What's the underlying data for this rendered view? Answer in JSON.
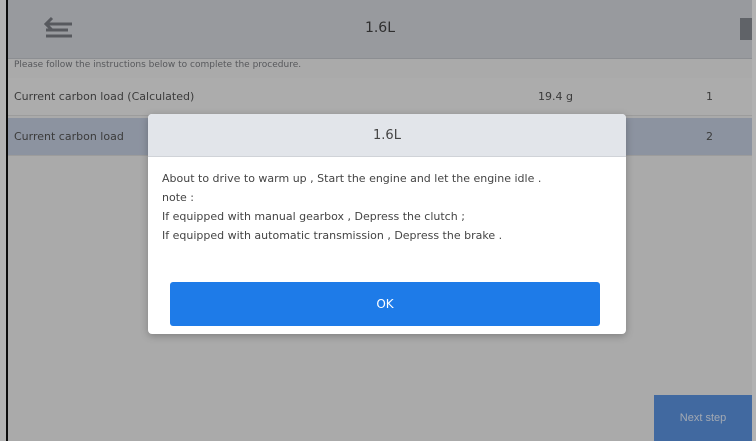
{
  "app": {
    "title": "1.6L",
    "subtitle": "Please follow the instructions below to complete the procedure."
  },
  "table": {
    "rows": [
      {
        "label": "Current carbon load (Calculated)",
        "value": "19.4 g",
        "index": "1"
      },
      {
        "label": "Current carbon load",
        "value": "",
        "index": "2"
      }
    ]
  },
  "corner_button": {
    "label": "Next step"
  },
  "dialog": {
    "title": "1.6L",
    "lines": [
      "About to drive to warm up , Start the engine and let the engine idle .",
      "note :",
      "If equipped with manual gearbox , Depress the clutch ;",
      "If equipped with automatic transmission , Depress the brake ."
    ],
    "ok_label": "OK"
  },
  "colors": {
    "accent": "#1e7be8",
    "header": "#e2e5ea",
    "selected_row": "#c9d3e6"
  }
}
